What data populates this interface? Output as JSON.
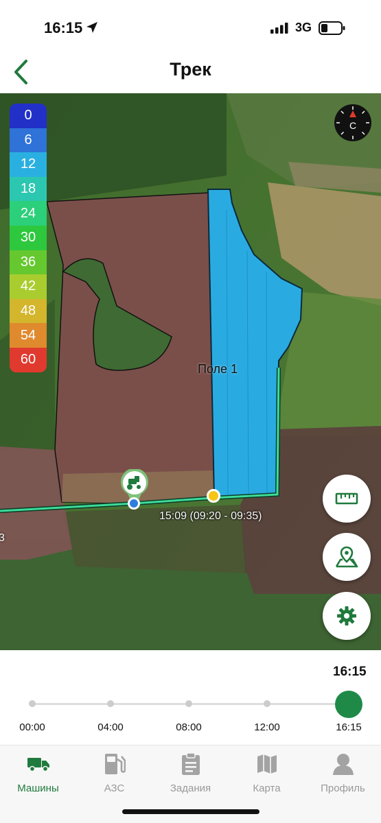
{
  "status_bar": {
    "time": "16:15",
    "network": "3G"
  },
  "nav": {
    "title": "Трек"
  },
  "map": {
    "speed_legend": [
      {
        "value": "0",
        "color": "#2230c8"
      },
      {
        "value": "6",
        "color": "#2f72d8"
      },
      {
        "value": "12",
        "color": "#2ab0e0"
      },
      {
        "value": "18",
        "color": "#2cc7b0"
      },
      {
        "value": "24",
        "color": "#2ccf7a"
      },
      {
        "value": "30",
        "color": "#2ec83e"
      },
      {
        "value": "36",
        "color": "#66c82f"
      },
      {
        "value": "42",
        "color": "#a9cd2e"
      },
      {
        "value": "48",
        "color": "#d3b62c"
      },
      {
        "value": "54",
        "color": "#e08a2e"
      },
      {
        "value": "60",
        "color": "#e03a2e"
      }
    ],
    "compass_letter": "С",
    "field_label": "Поле 1",
    "track_label": "15:09 (09:20 - 09:35)",
    "edge_label": "3",
    "colors": {
      "worked_area": "#29abe2",
      "track_line": "#3ddc97",
      "field_fill": "#7a4f4a"
    }
  },
  "timeline": {
    "current": "16:15",
    "ticks": [
      "00:00",
      "04:00",
      "08:00",
      "12:00",
      "16:15"
    ],
    "accent": "#1f8a48"
  },
  "tabs": [
    {
      "label": "Машины",
      "icon": "truck-icon",
      "active": true
    },
    {
      "label": "АЗС",
      "icon": "fuel-pump-icon",
      "active": false
    },
    {
      "label": "Задания",
      "icon": "clipboard-icon",
      "active": false
    },
    {
      "label": "Карта",
      "icon": "map-icon",
      "active": false
    },
    {
      "label": "Профиль",
      "icon": "person-icon",
      "active": false
    }
  ]
}
